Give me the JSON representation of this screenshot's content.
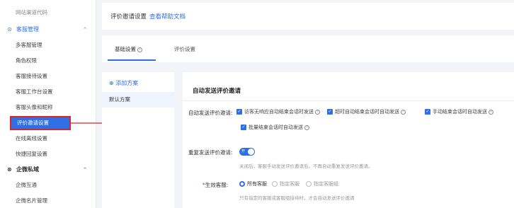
{
  "sidebar": {
    "top_partial": "网站渠道代码",
    "group1": {
      "label": "客服管理",
      "icon": "headset-icon"
    },
    "items": [
      {
        "label": "多客服管理"
      },
      {
        "label": "角色权限"
      },
      {
        "label": "客服接待设置"
      },
      {
        "label": "客服工作台设置"
      },
      {
        "label": "客服头像和昵称"
      },
      {
        "label": "评价邀请设置"
      },
      {
        "label": "在线离线设置"
      },
      {
        "label": "快捷回复设置"
      }
    ],
    "group2": {
      "label": "企微私域",
      "icon": "link-icon"
    },
    "items2": [
      {
        "label": "企微互通"
      },
      {
        "label": "企微名片管理"
      }
    ]
  },
  "header": {
    "title": "评价邀请设置",
    "help": "查看帮助文档"
  },
  "tabs": [
    {
      "label": "基础设置"
    },
    {
      "label": "评价设置"
    }
  ],
  "plans": {
    "add": "⊕ 添加方案",
    "default": "默认方案"
  },
  "main": {
    "section_title": "自动发送评价邀请",
    "auto_label": "自动发送评价邀请:",
    "auto_options": [
      "访客无响应自动结束会话时发送",
      "超时自动结束会话时自动发送",
      "手动结束会话时自动发送",
      "批量结束会话时自动发送"
    ],
    "repeat_label": "重复发送评价邀请:",
    "toggle_text": "开",
    "repeat_hint": "关闭后，客服手动发送评价邀请后，不再自动重复发送评价邀请。",
    "effective_label": "生效客服:",
    "effective_options": [
      "所有客服",
      "指定客服",
      "指定客服组"
    ],
    "effective_hint": "只有指定的客服或客服组接待时，才会自动发送评价邀请"
  },
  "colors": {
    "accent": "#2f6fe4",
    "highlight_border": "#d8262b"
  }
}
